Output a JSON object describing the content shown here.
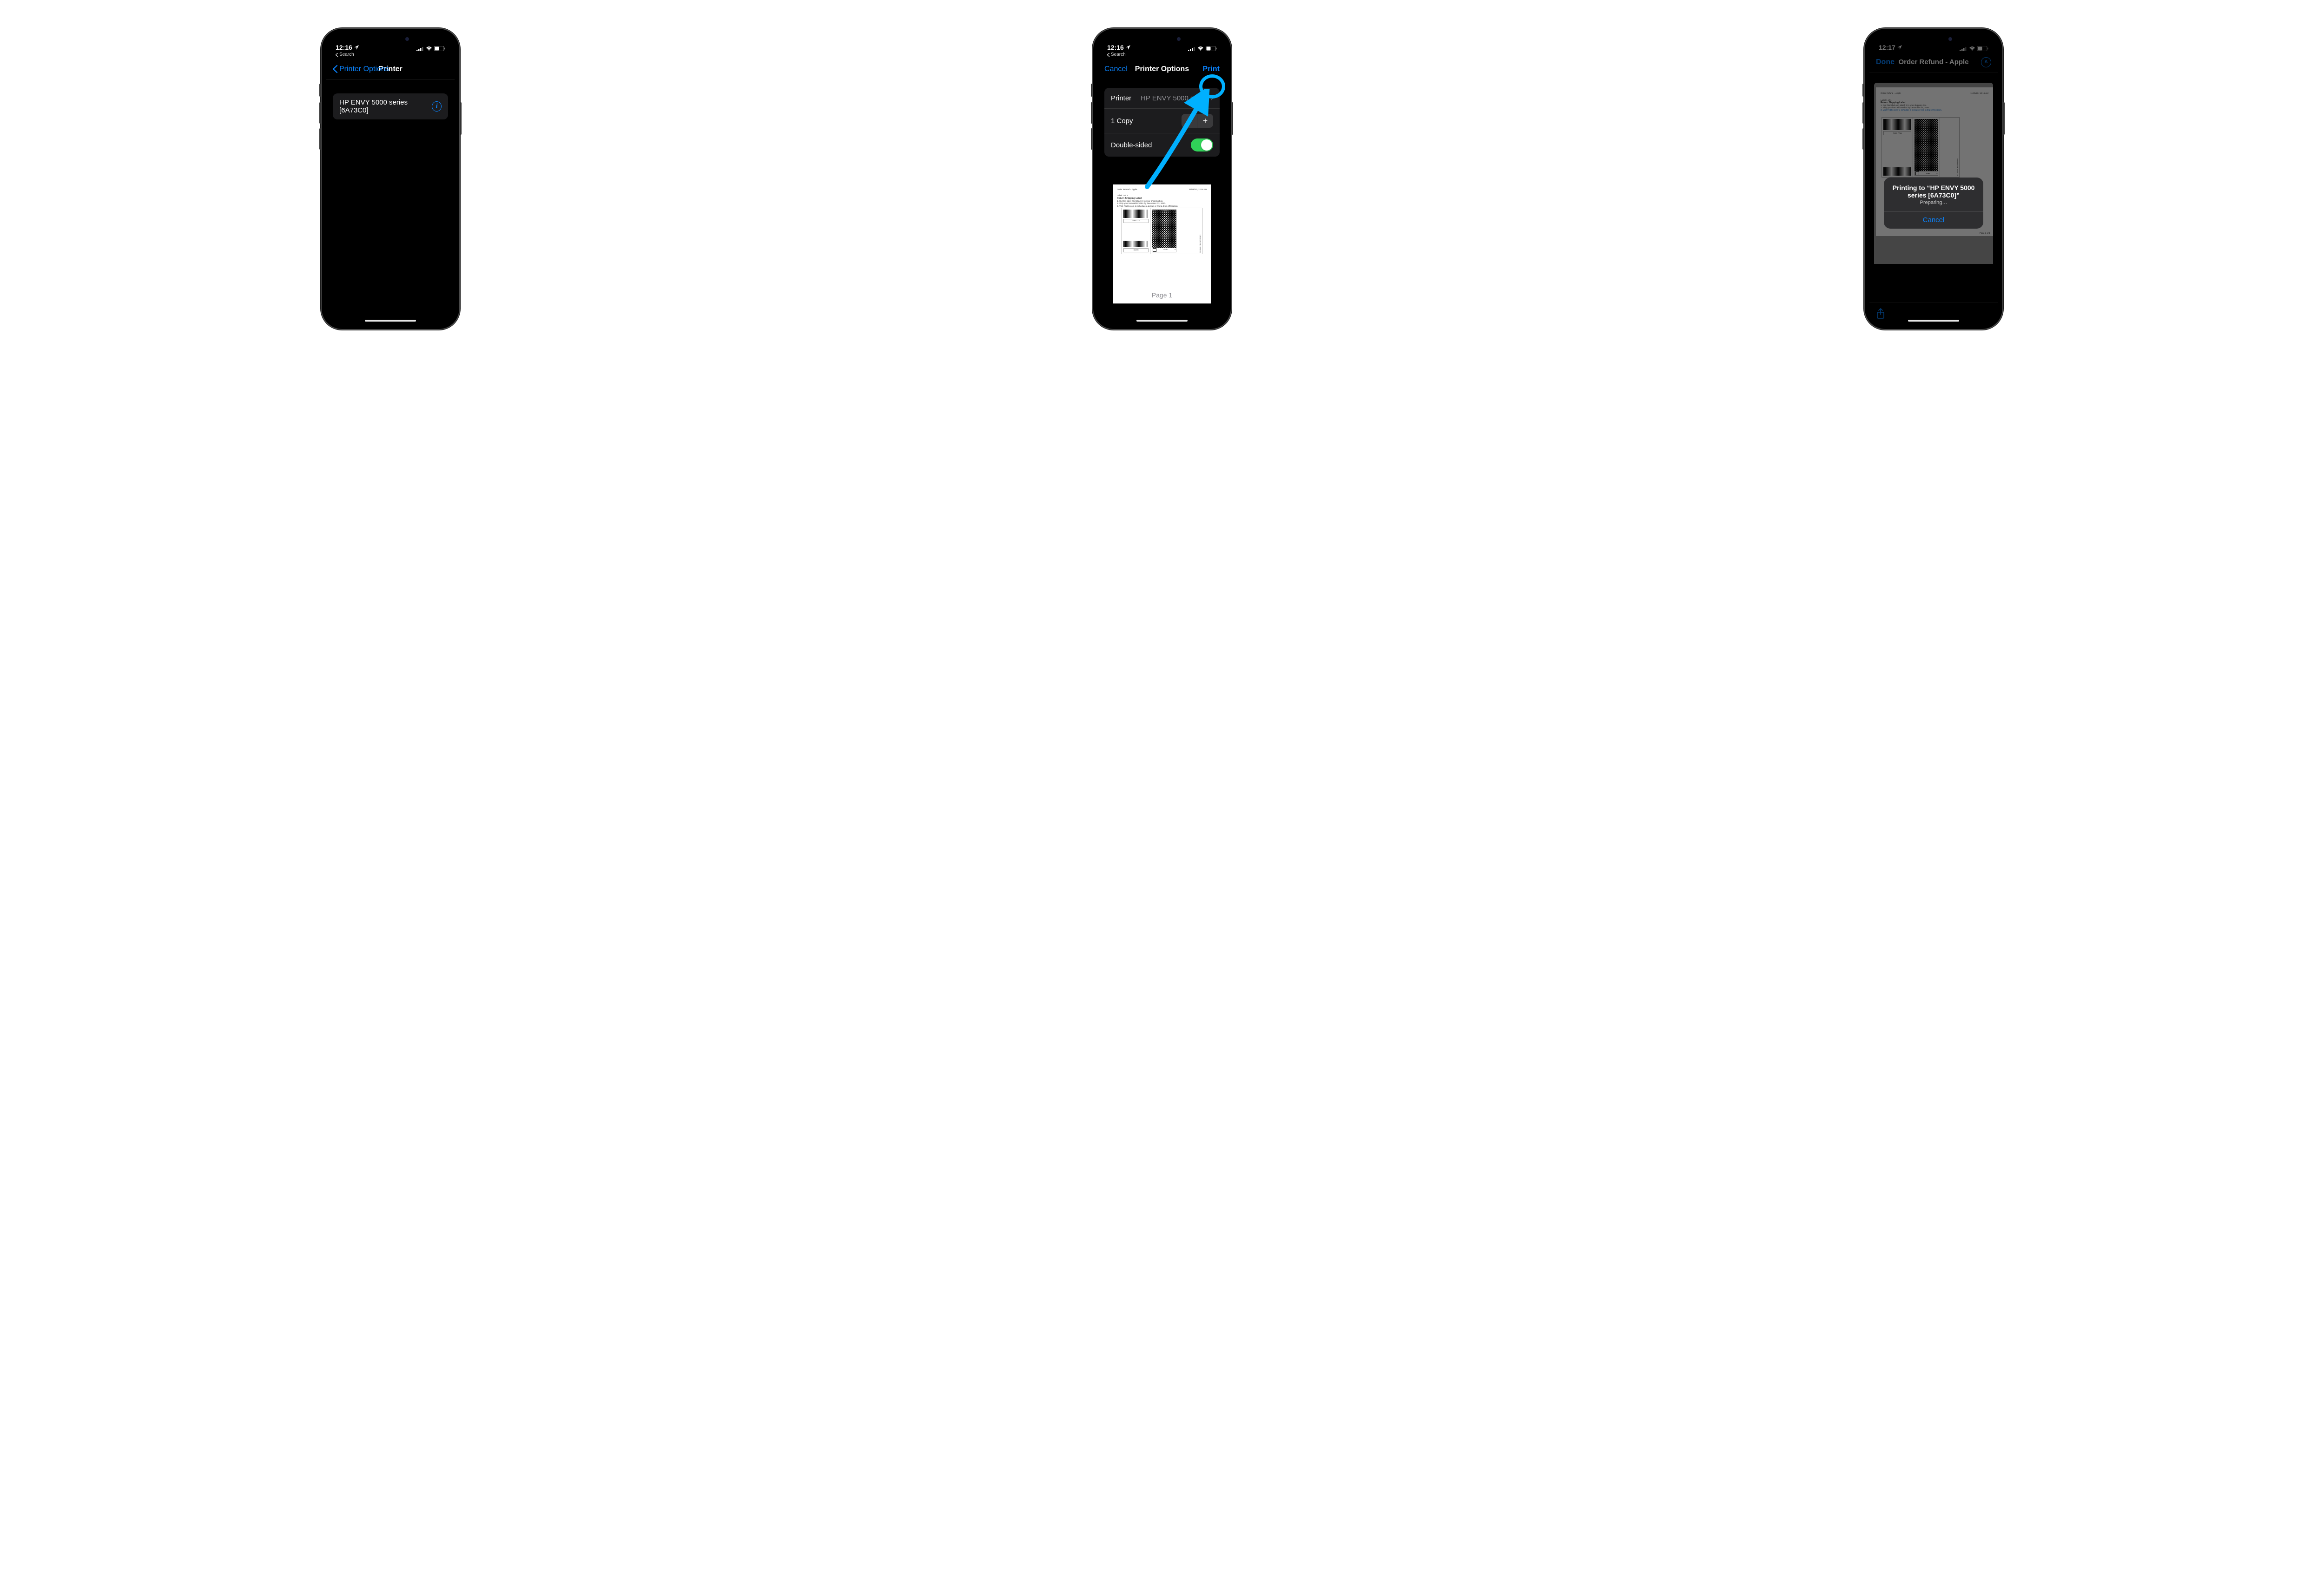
{
  "colors": {
    "accent": "#0a84ff",
    "highlight": "#00b0ff",
    "switchOn": "#30d158"
  },
  "phone1": {
    "status": {
      "time": "12:16",
      "backTo": "Search"
    },
    "nav": {
      "back": "Printer Options",
      "title": "Printer"
    },
    "row": {
      "title": "HP ENVY 5000 series [6A73C0]"
    }
  },
  "phone2": {
    "status": {
      "time": "12:16",
      "backTo": "Search"
    },
    "nav": {
      "cancel": "Cancel",
      "title": "Printer Options",
      "print": "Print"
    },
    "rows": {
      "printerLabel": "Printer",
      "printerValue": "HP ENVY 5000 series [6A73C0]",
      "copies": "1 Copy",
      "duplex": "Double-sided"
    },
    "preview": {
      "headerLeft": "Order Refund – Apple",
      "headerRight": "11/25/20, 12:16 AM",
      "labelLine": "Label 1 of 1",
      "title": "Return Shipping Label",
      "step1": "1. Cut this label and attach it to your shipping box.",
      "step2": "2. Ship your item with FedEx by December 03, 2020.",
      "step3": "3. Visit FedEx.com to schedule a pickup or find a drop-off location.",
      "tracking": "7199 7714",
      "trackingBottom": "31195",
      "pageNum": "Page 1"
    }
  },
  "phone3": {
    "status": {
      "time": "12:17"
    },
    "nav": {
      "done": "Done",
      "title": "Order Refund - Apple"
    },
    "doc": {
      "headerLeft": "Order Refund – Apple",
      "headerRight": "11/25/20, 12:16 AM",
      "labelLine": "Label 1 of 1",
      "title": "Return Shipping Label",
      "step1": "1. Cut this label and attach it to your shipping box.",
      "step2": "2. Ship your item with FedEx by December 03, 2020.",
      "step3": "3. Visit FedEx.com to schedule a pickup or find a drop-off location.",
      "tracking": "7199 7714",
      "foot": "Page 1 of 1"
    },
    "modal": {
      "title": "Printing to “HP ENVY 5000 series [6A73C0]”",
      "subtitle": "Preparing…",
      "cancel": "Cancel"
    }
  }
}
